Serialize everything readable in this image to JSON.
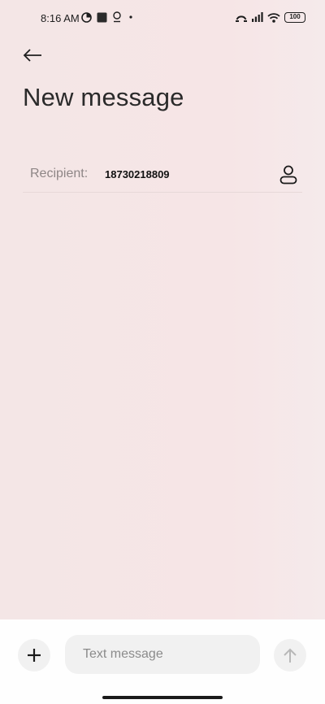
{
  "status_bar": {
    "time": "8:16 AM",
    "battery": "100",
    "icons_left": [
      "app-notification-icon",
      "square-notification-icon",
      "location-icon",
      "more-dot-icon"
    ],
    "icons_right": [
      "hotspot-icon",
      "signal-icon",
      "wifi-icon",
      "battery-icon"
    ]
  },
  "header": {
    "title": "New message"
  },
  "recipient": {
    "label": "Recipient:",
    "value": "18730218809"
  },
  "compose": {
    "placeholder": "Text message"
  },
  "colors": {
    "background": "#f6e5e6",
    "compose_bar": "#fefefe",
    "button_bg": "#f1f1f1",
    "text_primary": "#2a2a2a",
    "label_muted": "#8e8686"
  }
}
